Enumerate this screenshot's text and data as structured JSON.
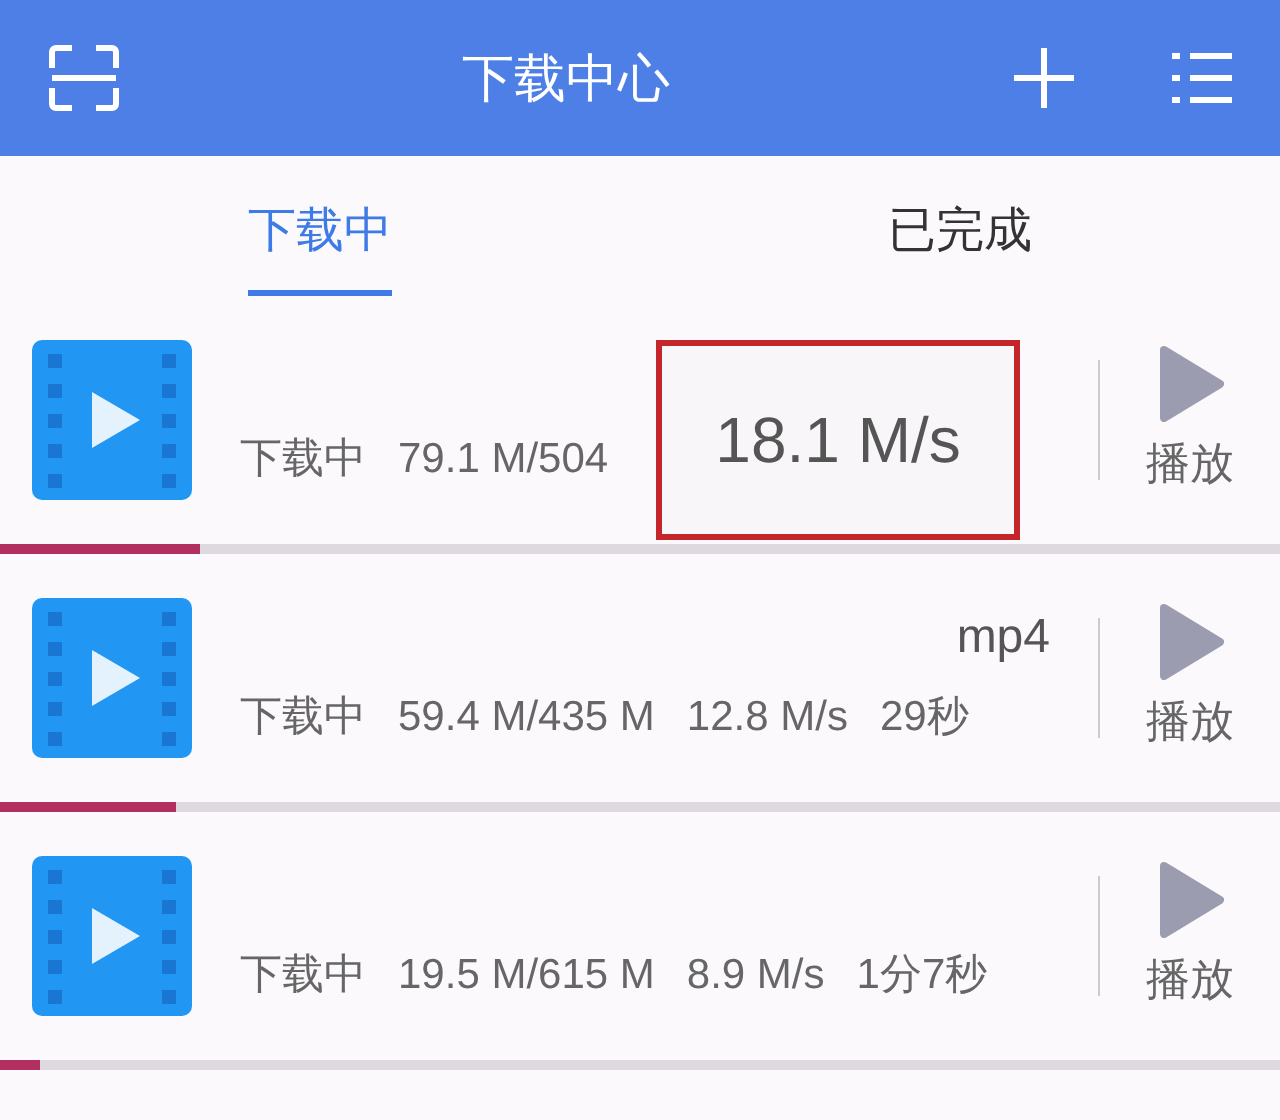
{
  "header": {
    "title": "下载中心"
  },
  "tabs": [
    {
      "label": "下载中",
      "selected": true
    },
    {
      "label": "已完成",
      "selected": false
    }
  ],
  "downloads": [
    {
      "status": "下载中",
      "size": "79.1 M/504",
      "level": 0.157,
      "action": "播放",
      "highlight": "18.1 M/s"
    },
    {
      "title": "mp4",
      "status": "下载中",
      "size": "59.4 M/435 M",
      "speed": "12.8 M/s",
      "time": "29秒",
      "level": 0.137,
      "action": "播放"
    },
    {
      "status": "下载中",
      "size": "19.5 M/615 M",
      "speed": "8.9 M/s",
      "time": "1分7秒",
      "level": 0.032,
      "action": "播放"
    }
  ]
}
